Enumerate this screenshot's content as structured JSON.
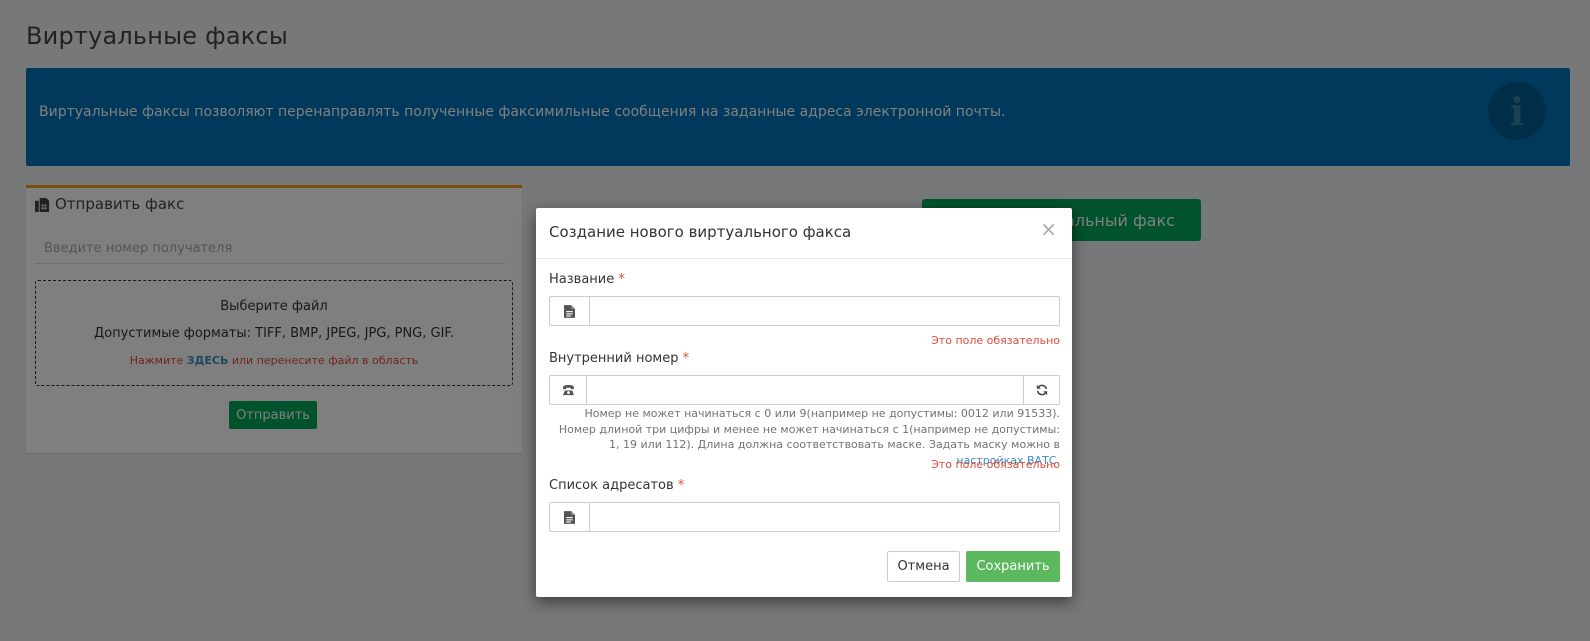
{
  "page": {
    "title": "Виртуальные факсы",
    "info_text": "Виртуальные факсы позволяют перенаправлять полученные факсимильные сообщения на заданные адреса электронной почты.",
    "info_icon": "info-circle-icon"
  },
  "send_fax": {
    "header": "Отправить факс",
    "header_icon": "fax-icon",
    "recipient_placeholder": "Введите номер получателя",
    "dropzone": {
      "title": "Выберите файл",
      "formats": "Допустимые форматы: TIFF, BMP, JPEG, JPG, PNG, GIF.",
      "hint_before": "Нажмите ",
      "hint_link": "ЗДЕСЬ",
      "hint_after": " или перенесите файл в область"
    },
    "send_label": "Отправить"
  },
  "create_button": {
    "label": "Создать виртуальный факс"
  },
  "modal": {
    "title": "Создание нового виртуального факса",
    "close": "×",
    "required_mark": "*",
    "name": {
      "label": "Название",
      "icon": "file-icon",
      "value": "",
      "error": "Это поле обязательно"
    },
    "extension": {
      "label": "Внутренний номер",
      "icon": "phone-icon",
      "refresh_icon": "refresh-icon",
      "value": "",
      "help_text": "Номер не может начинаться с 0 или 9(например не допустимы: 0012 или 91533). Номер длиной три цифры и менее не может начинаться с 1(например не допустимы: 1, 19 или 112). Длина должна соответствовать маске. Задать маску можно в ",
      "help_link": "настройках ВАТС",
      "help_end": ".",
      "error": "Это поле обязательно"
    },
    "recipients": {
      "label": "Список адресатов",
      "icon": "file-icon",
      "value": ""
    },
    "cancel_label": "Отмена",
    "save_label": "Сохранить"
  },
  "colors": {
    "info_bg": "#0073b7",
    "fax_box_border": "#f39c12",
    "success": "#00a65a",
    "save_button": "#5cb85c",
    "error": "#dd4b39",
    "link": "#3c8dbc"
  }
}
